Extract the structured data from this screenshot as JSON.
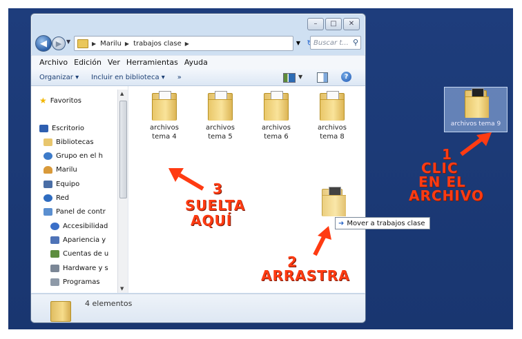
{
  "window": {
    "controls": {
      "minimize": "–",
      "maximize": "□",
      "close": "✕"
    }
  },
  "address": {
    "crumbs": [
      "Marilu",
      "trabajos clase"
    ],
    "search_placeholder": "Buscar t..."
  },
  "menu": [
    "Archivo",
    "Edición",
    "Ver",
    "Herramientas",
    "Ayuda"
  ],
  "toolbar": {
    "organize": "Organizar ▾",
    "library": "Incluir en biblioteca ▾",
    "more": "»"
  },
  "nav": {
    "items": [
      "Favoritos",
      "Escritorio",
      "Bibliotecas",
      "Grupo en el h",
      "Marilu",
      "Equipo",
      "Red",
      "Panel de contr",
      "Accesibilidad",
      "Apariencia y",
      "Cuentas de u",
      "Hardware y s",
      "Programas"
    ]
  },
  "folders": [
    {
      "name": "archivos\ntema 4"
    },
    {
      "name": "archivos\ntema 5"
    },
    {
      "name": "archivos\ntema 6"
    },
    {
      "name": "archivos\ntema 8"
    }
  ],
  "status": {
    "count": "4 elementos"
  },
  "desktop_icon": {
    "label": "archivos tema 9"
  },
  "tooltip": {
    "text": "Mover a trabajos clase"
  },
  "annotations": {
    "step1_num": "1",
    "step1_a": "CLIC",
    "step1_b": "EN EL",
    "step1_c": "ARCHIVO",
    "step2_num": "2",
    "step2_a": "ARRASTRA",
    "step3_num": "3",
    "step3_a": "SUELTA",
    "step3_b": "AQUÍ"
  },
  "colors": {
    "desktop": "#1e3d7c",
    "annotation": "#ff3b12",
    "folder": "#f6dc8b"
  }
}
